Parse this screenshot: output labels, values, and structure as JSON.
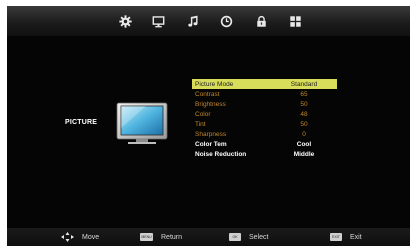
{
  "top_tabs": [
    {
      "name": "settings",
      "icon": "gear-icon"
    },
    {
      "name": "display",
      "icon": "monitor-icon"
    },
    {
      "name": "sound",
      "icon": "music-note-icon"
    },
    {
      "name": "time",
      "icon": "clock-icon"
    },
    {
      "name": "lock",
      "icon": "lock-icon"
    },
    {
      "name": "setup",
      "icon": "grid-icon"
    }
  ],
  "section_title": "PICTURE",
  "menu": [
    {
      "label": "Picture Mode",
      "value": "Standard",
      "selected": true
    },
    {
      "label": "Contrast",
      "value": "65"
    },
    {
      "label": "Brightness",
      "value": "50"
    },
    {
      "label": "Color",
      "value": "48"
    },
    {
      "label": "Tint",
      "value": "50"
    },
    {
      "label": "Sharpness",
      "value": "0"
    },
    {
      "label": "Color Tem",
      "value": "Cool"
    },
    {
      "label": "Noise Reduction",
      "value": "Middle"
    }
  ],
  "footer": {
    "move": "Move",
    "menu_key": "MENU",
    "return": "Return",
    "ok_key": "OK",
    "select": "Select",
    "exit_key": "EXIT",
    "exit": "Exit"
  },
  "colors": {
    "highlight": "#d8dd5a",
    "item_text": "#c2872c",
    "panel": "#050505"
  }
}
